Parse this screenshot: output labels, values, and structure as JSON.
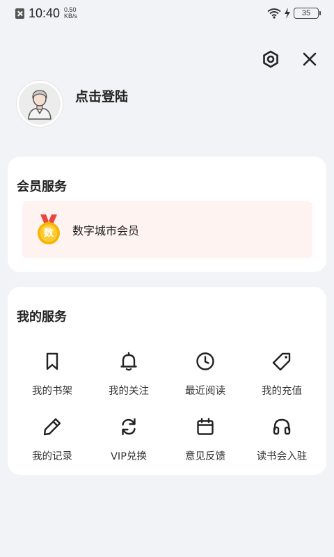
{
  "status_bar": {
    "time": "10:40",
    "speed_value": "0.50",
    "speed_unit": "KB/s",
    "battery": "35"
  },
  "header": {
    "settings_icon": "settings-icon",
    "close_icon": "close-icon"
  },
  "profile": {
    "login_label": "点击登陆"
  },
  "vip_section": {
    "title": "会员服务",
    "item_label": "数字城市会员",
    "medal_char": "数"
  },
  "services": {
    "title": "我的服务",
    "items": [
      {
        "label": "我的书架",
        "icon": "bookmark-icon"
      },
      {
        "label": "我的关注",
        "icon": "bell-icon"
      },
      {
        "label": "最近阅读",
        "icon": "clock-icon"
      },
      {
        "label": "我的充值",
        "icon": "tag-icon"
      },
      {
        "label": "我的记录",
        "icon": "pencil-icon"
      },
      {
        "label": "VIP兑换",
        "icon": "refresh-icon"
      },
      {
        "label": "意见反馈",
        "icon": "calendar-icon"
      },
      {
        "label": "读书会入驻",
        "icon": "headset-icon"
      }
    ]
  },
  "colors": {
    "background": "#f2f3f7",
    "card": "#ffffff",
    "vip_row": "#fff3f2",
    "medal_gold": "#f7b500",
    "ribbon_red": "#e6483d"
  }
}
